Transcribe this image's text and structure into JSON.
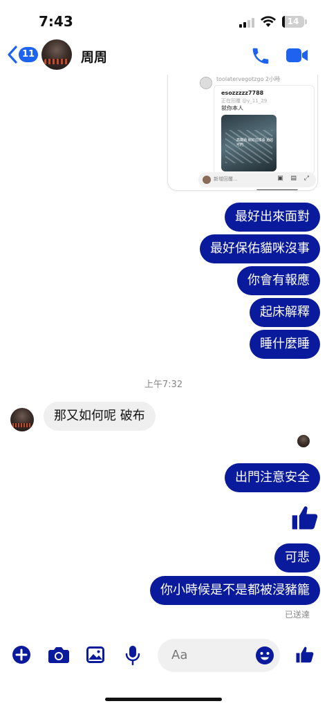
{
  "status": {
    "time": "7:43",
    "battery": "14",
    "battery_level": 0.14
  },
  "header": {
    "back_badge": "11",
    "contact_name": "周周",
    "icons": [
      "back-chevron-icon",
      "phone-icon",
      "video-camera-icon"
    ]
  },
  "shared_post": {
    "top_user": "toolatervegotzgo 2小時",
    "username": "esozzzzz7788",
    "time": "2小時",
    "reply_to": "正在回覆 @y_11_29",
    "text": "就你本人",
    "image_caption": "高鐵過 就好這樣張 過的可們",
    "reply_placeholder": "新增回覆..."
  },
  "messages_sent_1": [
    "最好出來面對",
    "最好保佑貓咪沒事",
    "你會有報應",
    "起床解釋",
    "睡什麼睡"
  ],
  "timestamp": "上午7:32",
  "message_received": "那又如何呢 破布",
  "messages_sent_2": [
    "出門注意安全",
    "可悲",
    "你小時候是不是都被浸豬籠"
  ],
  "sent_status": "已送達",
  "composer": {
    "placeholder": "Aa",
    "icons": [
      "plus-icon",
      "camera-icon",
      "photo-icon",
      "microphone-icon",
      "emoji-icon",
      "thumbs-up-icon"
    ]
  },
  "colors": {
    "accent": "#1e63f0",
    "bubble_out": "#0a1a9c",
    "bubble_in": "#efefef"
  }
}
